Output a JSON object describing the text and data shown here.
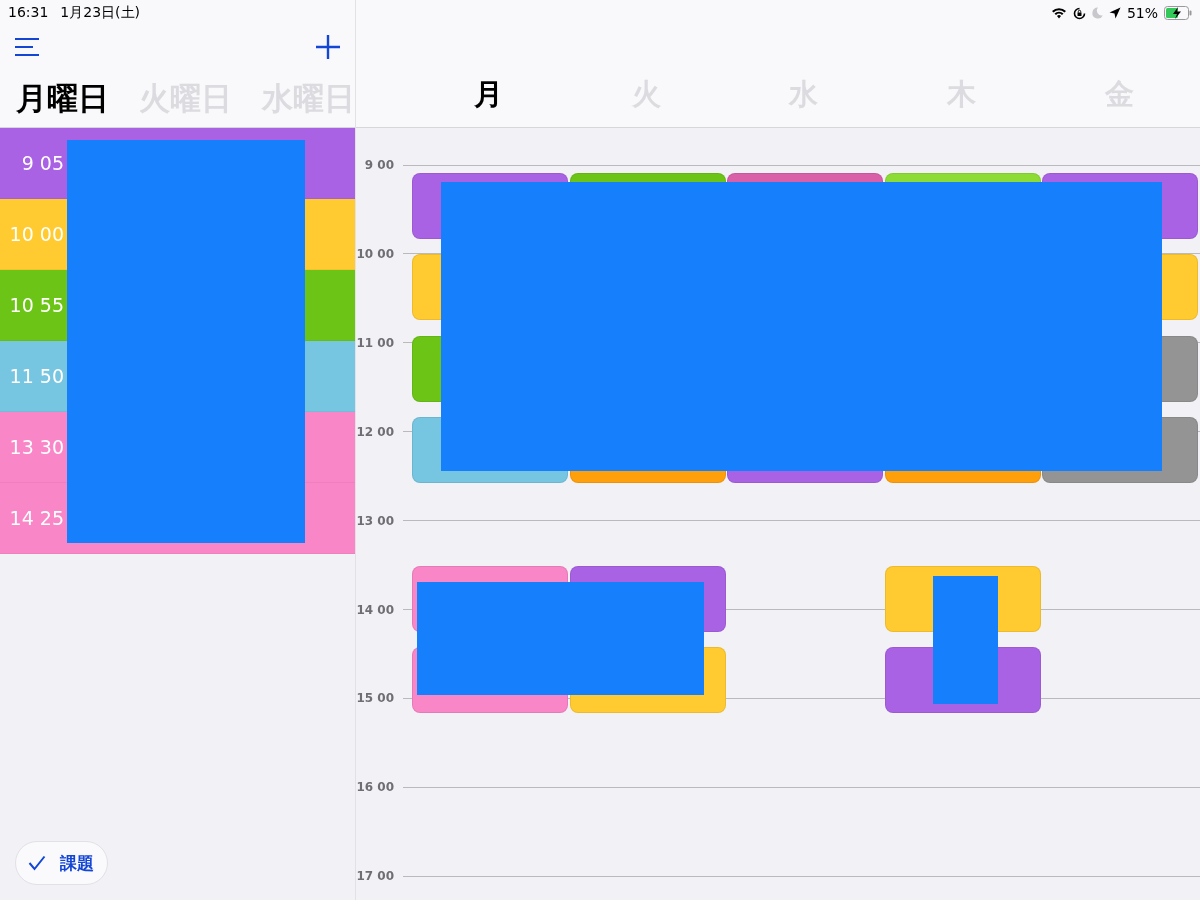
{
  "status_bar": {
    "time": "16:31",
    "date": "1月23日(土)",
    "battery": "51%"
  },
  "sidebar": {
    "day_tabs": [
      {
        "label": "月曜日",
        "selected": true
      },
      {
        "label": "火曜日",
        "selected": false
      },
      {
        "label": "水曜日",
        "selected": false
      }
    ],
    "periods": [
      {
        "time": "9 05",
        "color": "#a962e4"
      },
      {
        "time": "10 00",
        "color": "#ffcb30"
      },
      {
        "time": "10 55",
        "color": "#6cc416"
      },
      {
        "time": "11 50",
        "color": "#76c5e1"
      },
      {
        "time": "13 30",
        "color": "#f986c6"
      },
      {
        "time": "14 25",
        "color": "#f986c6"
      }
    ],
    "task_button": {
      "label": "課題"
    }
  },
  "timetable": {
    "day_tabs": [
      {
        "label": "月",
        "selected": true
      },
      {
        "label": "火",
        "selected": false
      },
      {
        "label": "水",
        "selected": false
      },
      {
        "label": "木",
        "selected": false
      },
      {
        "label": "金",
        "selected": false
      }
    ],
    "hours": [
      "9 00",
      "10 00",
      "11 00",
      "12 00",
      "13 00",
      "14 00",
      "15 00",
      "16 00",
      "17 00"
    ],
    "rows": [
      {
        "cells": [
          {
            "kind": "class",
            "color": "#a962e4"
          },
          {
            "kind": "class",
            "color": "#6cc416"
          },
          {
            "kind": "class",
            "color": "#d95fa8"
          },
          {
            "kind": "class",
            "color": "#8ddc35"
          },
          {
            "kind": "class",
            "color": "#a962e4"
          }
        ]
      },
      {
        "cells": [
          {
            "kind": "class",
            "color": "#ffcb30"
          },
          {
            "kind": "empty"
          },
          {
            "kind": "empty"
          },
          {
            "kind": "empty"
          },
          {
            "kind": "class",
            "color": "#ffcb30"
          }
        ]
      },
      {
        "cells": [
          {
            "kind": "class",
            "color": "#6cc416"
          },
          {
            "kind": "empty"
          },
          {
            "kind": "empty"
          },
          {
            "kind": "empty"
          },
          {
            "kind": "class",
            "color": "#949494"
          }
        ]
      },
      {
        "cells": [
          {
            "kind": "class",
            "color": "#76c5e1"
          },
          {
            "kind": "class",
            "color": "#ff9f0a"
          },
          {
            "kind": "class",
            "color": "#a962e4"
          },
          {
            "kind": "class",
            "color": "#ff9f0a"
          },
          {
            "kind": "class",
            "color": "#949494"
          }
        ]
      },
      {
        "cells": [
          {
            "kind": "class",
            "color": "#f986c6"
          },
          {
            "kind": "class",
            "color": "#a962e4"
          },
          {
            "kind": "empty"
          },
          {
            "kind": "class",
            "color": "#ffcb30"
          },
          {
            "kind": "empty"
          }
        ]
      },
      {
        "cells": [
          {
            "kind": "class",
            "color": "#f986c6"
          },
          {
            "kind": "class",
            "color": "#ffcb30"
          },
          {
            "kind": "empty"
          },
          {
            "kind": "class",
            "color": "#a962e4"
          },
          {
            "kind": "empty"
          }
        ]
      }
    ]
  }
}
